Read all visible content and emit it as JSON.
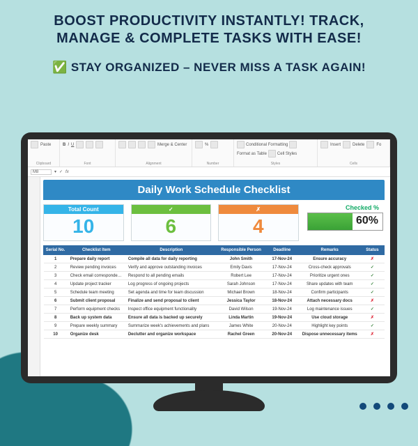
{
  "promo": {
    "headline": "BOOST PRODUCTIVITY INSTANTLY! TRACK, MANAGE & COMPLETE TASKS WITH EASE!",
    "subhead": "STAY ORGANIZED – NEVER MISS A TASK AGAIN!",
    "check": "✅"
  },
  "ribbon": {
    "groups": {
      "clipboard": "Clipboard",
      "font": "Font",
      "alignment": "Alignment",
      "number": "Number",
      "styles": "Styles",
      "cells": "Cells"
    },
    "paste": "Paste",
    "merge": "Merge & Center",
    "cond": "Conditional Formatting",
    "fmt": "Format as Table",
    "cellstyles": "Cell Styles",
    "insert": "Insert",
    "delete": "Delete",
    "format": "Fo"
  },
  "formula_bar": {
    "cell": "M8",
    "fx": "fx"
  },
  "sheet": {
    "title": "Daily Work Schedule Checklist",
    "cards": {
      "total_label": "Total Count",
      "total": "10",
      "done_icon": "✓",
      "done": "6",
      "left_icon": "✗",
      "left": "4",
      "pct_label": "Checked %",
      "pct": "60%"
    },
    "columns": [
      "Serial No.",
      "Checklist Item",
      "Description",
      "Responsible Person",
      "Deadline",
      "Remarks",
      "Status"
    ],
    "rows": [
      {
        "n": "1",
        "item": "Prepare daily report",
        "desc": "Compile all data for daily reporting",
        "who": "John Smith",
        "dl": "17-Nov-24",
        "rk": "Ensure accuracy",
        "st": "x",
        "hl": true
      },
      {
        "n": "2",
        "item": "Review pending invoices",
        "desc": "Verify and approve outstanding invoices",
        "who": "Emily Davis",
        "dl": "17-Nov-24",
        "rk": "Cross-check approvals",
        "st": "v",
        "hl": false
      },
      {
        "n": "3",
        "item": "Check email correspondence",
        "desc": "Respond to all pending emails",
        "who": "Robert Lee",
        "dl": "17-Nov-24",
        "rk": "Prioritize urgent ones",
        "st": "v",
        "hl": false
      },
      {
        "n": "4",
        "item": "Update project tracker",
        "desc": "Log progress of ongoing projects",
        "who": "Sarah Johnson",
        "dl": "17-Nov-24",
        "rk": "Share updates with team",
        "st": "v",
        "hl": false
      },
      {
        "n": "5",
        "item": "Schedule team meeting",
        "desc": "Set agenda and time for team discussion",
        "who": "Michael Brown",
        "dl": "18-Nov-24",
        "rk": "Confirm participants",
        "st": "v",
        "hl": false
      },
      {
        "n": "6",
        "item": "Submit client proposal",
        "desc": "Finalize and send proposal to client",
        "who": "Jessica Taylor",
        "dl": "18-Nov-24",
        "rk": "Attach necessary docs",
        "st": "x",
        "hl": true
      },
      {
        "n": "7",
        "item": "Perform equipment checks",
        "desc": "Inspect office equipment functionality",
        "who": "David Wilson",
        "dl": "19-Nov-24",
        "rk": "Log maintenance issues",
        "st": "v",
        "hl": false
      },
      {
        "n": "8",
        "item": "Back up system data",
        "desc": "Ensure all data is backed up securely",
        "who": "Linda Martin",
        "dl": "19-Nov-24",
        "rk": "Use cloud storage",
        "st": "x",
        "hl": true
      },
      {
        "n": "9",
        "item": "Prepare weekly summary",
        "desc": "Summarize week's achievements and plans",
        "who": "James White",
        "dl": "20-Nov-24",
        "rk": "Highlight key points",
        "st": "v",
        "hl": false
      },
      {
        "n": "10",
        "item": "Organize desk",
        "desc": "Declutter and organize workspace",
        "who": "Rachel Green",
        "dl": "20-Nov-24",
        "rk": "Dispose unnecessary items",
        "st": "x",
        "hl": true
      }
    ]
  }
}
